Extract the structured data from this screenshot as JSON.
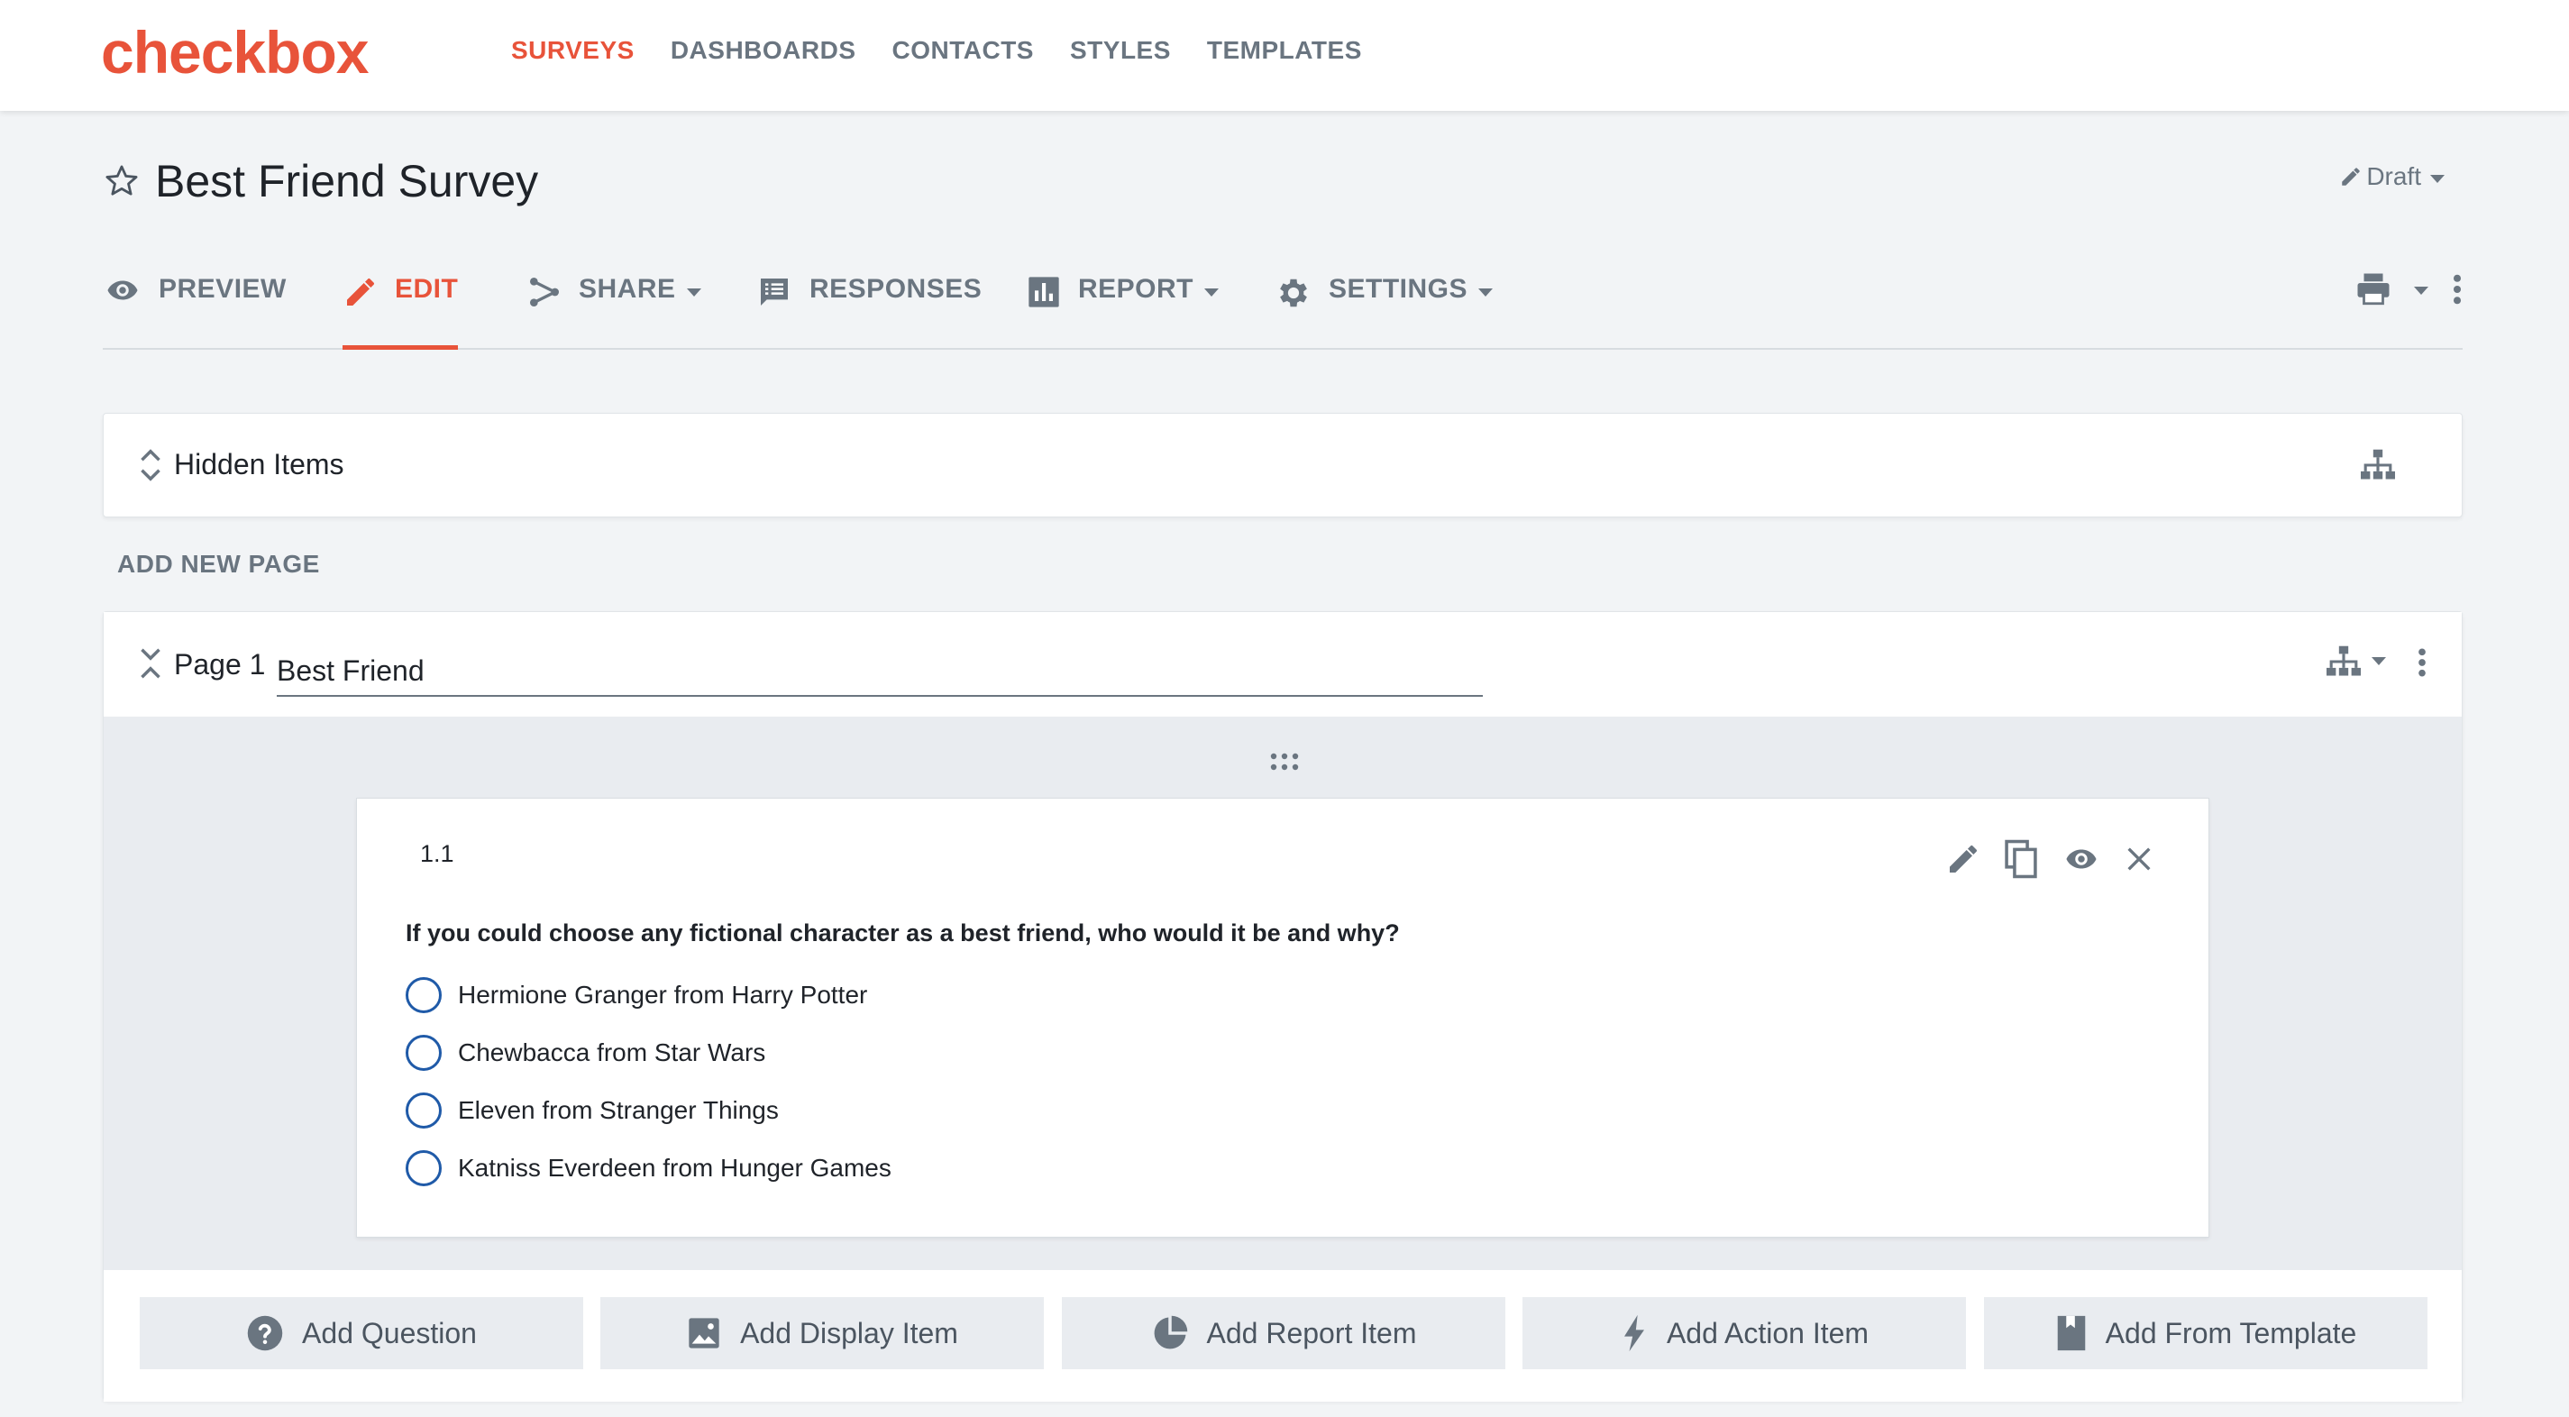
{
  "app": {
    "logo": "checkbox"
  },
  "topnav": {
    "items": [
      {
        "label": "SURVEYS",
        "active": true
      },
      {
        "label": "DASHBOARDS"
      },
      {
        "label": "CONTACTS"
      },
      {
        "label": "STYLES"
      },
      {
        "label": "TEMPLATES"
      }
    ]
  },
  "survey": {
    "title": "Best Friend Survey",
    "status": "Draft"
  },
  "tabs": [
    {
      "label": "PREVIEW",
      "icon": "eye-icon"
    },
    {
      "label": "EDIT",
      "icon": "pencil-icon",
      "active": true
    },
    {
      "label": "SHARE",
      "icon": "share-icon",
      "dropdown": true
    },
    {
      "label": "RESPONSES",
      "icon": "responses-icon"
    },
    {
      "label": "REPORT",
      "icon": "chart-icon",
      "dropdown": true
    },
    {
      "label": "SETTINGS",
      "icon": "gear-icon",
      "dropdown": true
    }
  ],
  "hidden_items": {
    "label": "Hidden Items"
  },
  "add_new_page": "ADD NEW PAGE",
  "page": {
    "label": "Page 1",
    "name": "Best Friend",
    "question": {
      "number": "1.1",
      "text": "If you could choose any fictional character as a best friend, who would it be and why?",
      "options": [
        "Hermione Granger from Harry Potter",
        "Chewbacca from Star Wars",
        "Eleven from Stranger Things",
        "Katniss Everdeen from Hunger Games"
      ]
    }
  },
  "add_buttons": [
    {
      "label": "Add Question",
      "icon": "question-icon"
    },
    {
      "label": "Add Display Item",
      "icon": "image-icon"
    },
    {
      "label": "Add Report Item",
      "icon": "pie-icon"
    },
    {
      "label": "Add Action Item",
      "icon": "bolt-icon"
    },
    {
      "label": "Add From Template",
      "icon": "template-icon"
    }
  ],
  "colors": {
    "accent": "#e8533a",
    "muted": "#6a7580",
    "radio": "#1f5aa8",
    "background": "#f2f4f6"
  }
}
